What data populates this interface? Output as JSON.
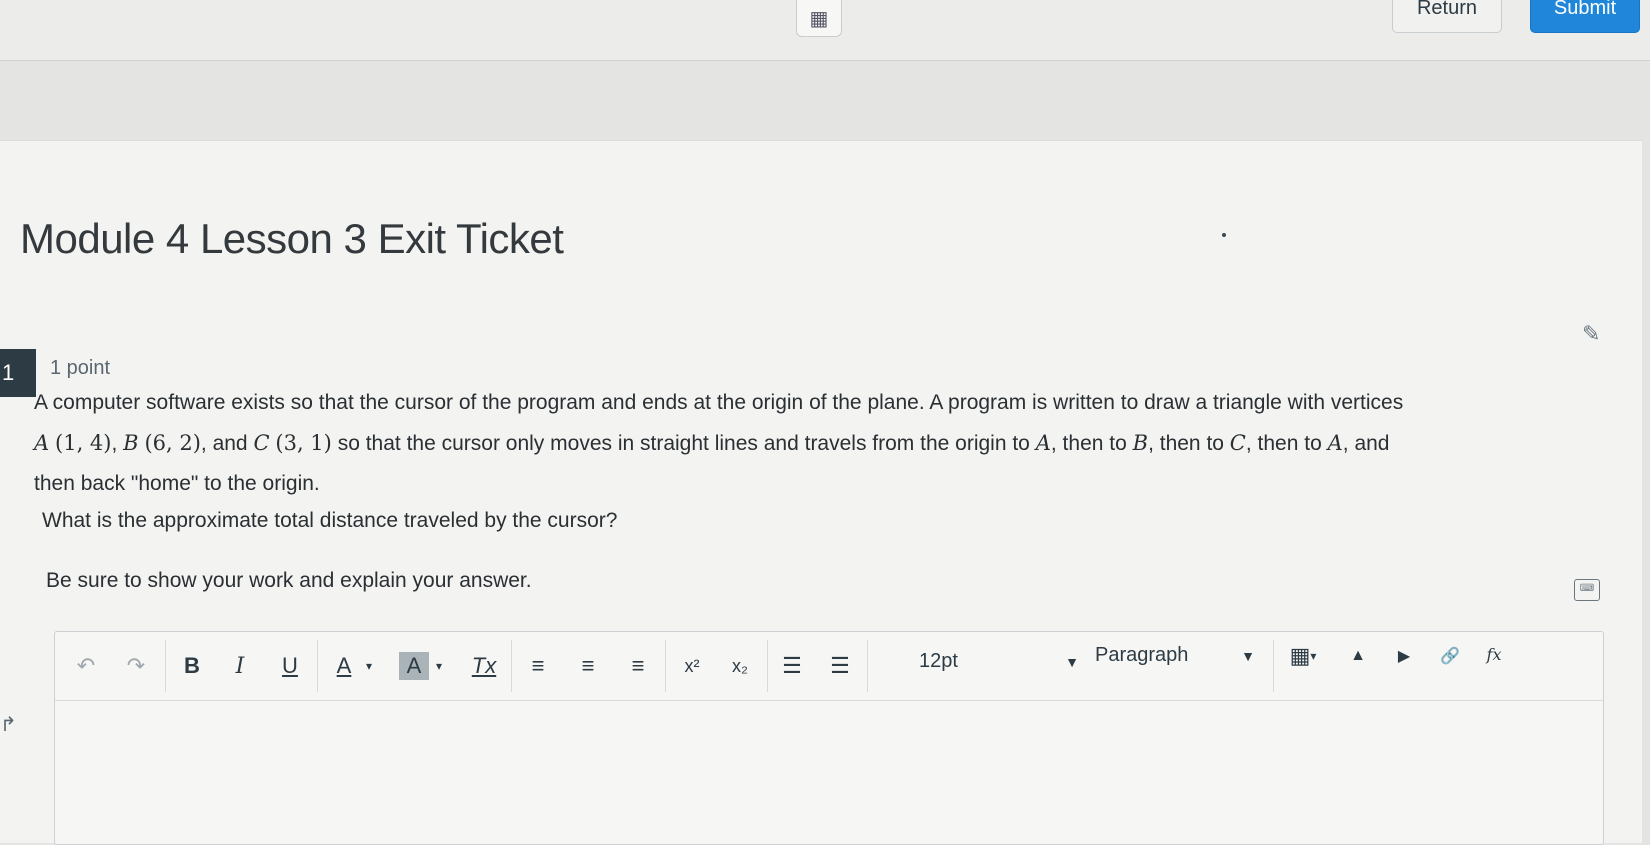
{
  "header": {
    "calculator_icon": "calculator-icon",
    "return_label": "Return",
    "submit_label": "Submit"
  },
  "page": {
    "title": "Module 4 Lesson 3 Exit Ticket"
  },
  "question": {
    "number": "1",
    "points": "1 point",
    "paragraph_1a": "A computer software exists so that the cursor of the program and ends at the origin of the plane. A program is written to draw a triangle with vertices",
    "pA_label": "A",
    "pA_coords": "(1, 4)",
    "pB_label": "B",
    "pB_coords": "(6, 2)",
    "and_word": ", and",
    "pC_label": "C",
    "pC_coords": "(3, 1)",
    "paragraph_1b": "so that the cursor only moves in straight lines and travels from the origin to",
    "A": "A",
    "then_to": ", then to",
    "B": "B",
    "C": "C",
    "then_to_and": ", and",
    "paragraph_1c": "then back \"home\" to the origin.",
    "prompt_2": "What is the approximate total distance traveled by the cursor?",
    "prompt_3": "Be sure to show your work and explain your answer."
  },
  "editor": {
    "font_size": "12pt",
    "block_format": "Paragraph",
    "toolbar": {
      "undo": "↶",
      "redo": "↷",
      "bold": "B",
      "italic": "I",
      "underline": "U",
      "text_color": "A",
      "bg_color": "A",
      "clear_format": "Tx",
      "align_left": "≡",
      "align_center": "≡",
      "align_right": "≡",
      "superscript": "x²",
      "subscript": "x₂",
      "bullet_list": "☰",
      "numbered_list": "☰",
      "table": "▦",
      "image": "▲",
      "media": "▶",
      "link": "🔗",
      "equation": "fx"
    }
  }
}
